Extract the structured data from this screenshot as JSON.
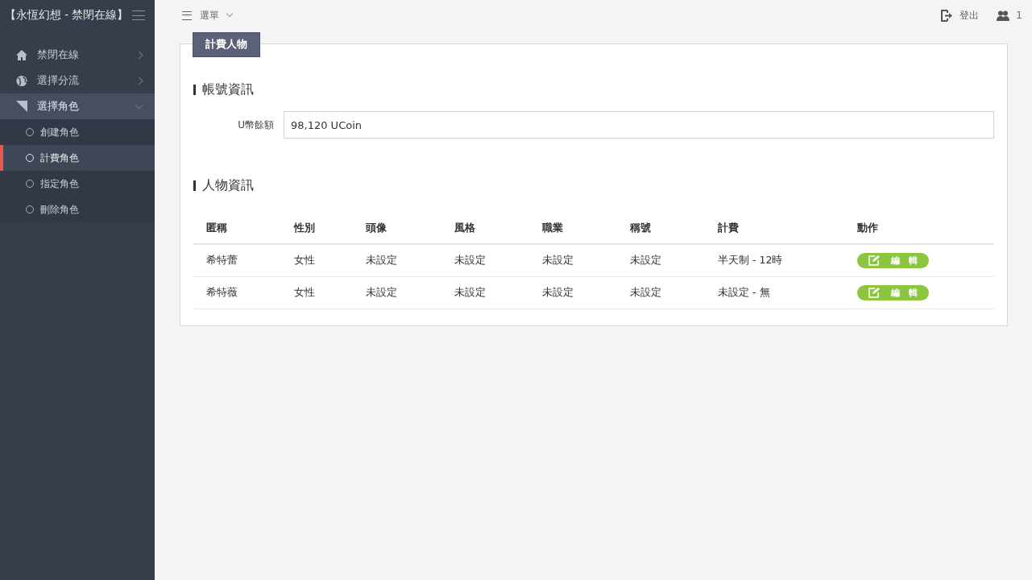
{
  "sidebar": {
    "brand": "【永恆幻想 - 禁閉在線】",
    "items": [
      {
        "label": "禁閉在線",
        "expanded": false,
        "selected": false
      },
      {
        "label": "選擇分流",
        "expanded": false,
        "selected": false
      },
      {
        "label": "選擇角色",
        "expanded": true,
        "selected": true,
        "children": [
          {
            "label": "創建角色",
            "selected": false
          },
          {
            "label": "計費角色",
            "selected": true
          },
          {
            "label": "指定角色",
            "selected": false
          },
          {
            "label": "刪除角色",
            "selected": false
          }
        ]
      }
    ]
  },
  "topbar": {
    "menu": "選單",
    "logout": "登出",
    "users": "1"
  },
  "panel": {
    "tab": "計費人物",
    "account": {
      "heading": "帳號資訊",
      "field_label": "U幣餘額",
      "field_value": "98,120 UCoin"
    },
    "characters": {
      "heading": "人物資訊",
      "columns": [
        "匿稱",
        "性別",
        "頭像",
        "風格",
        "職業",
        "稱號",
        "計費",
        "動作"
      ],
      "rows": [
        {
          "cells": [
            "希特蕾",
            "女性",
            "未設定",
            "未設定",
            "未設定",
            "未設定",
            "半天制 - 12時"
          ],
          "action": "編　輯"
        },
        {
          "cells": [
            "希特薇",
            "女性",
            "未設定",
            "未設定",
            "未設定",
            "未設定",
            "未設定 - 無"
          ],
          "action": "編　輯"
        }
      ]
    }
  }
}
